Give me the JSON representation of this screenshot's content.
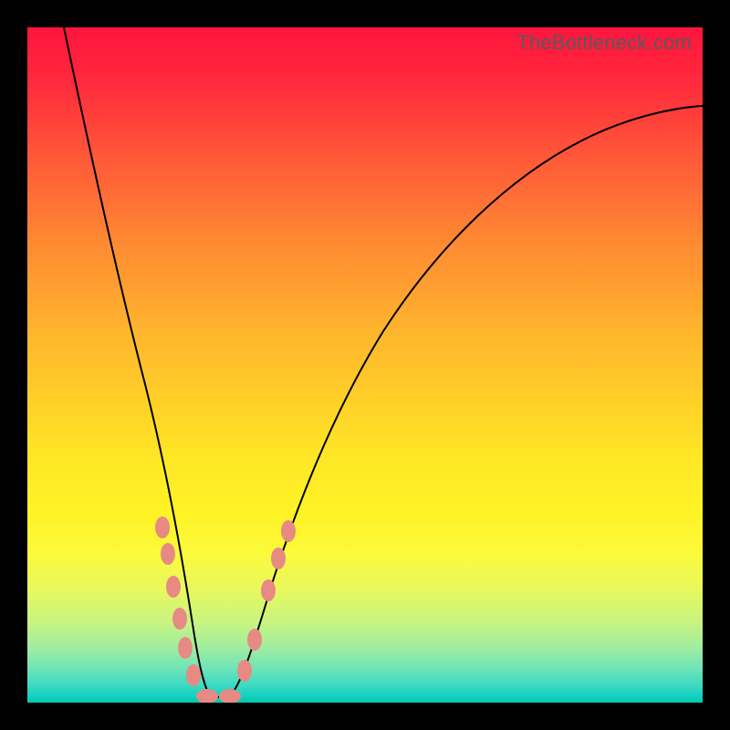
{
  "watermark": "TheBottleneck.com",
  "colors": {
    "frame": "#000000",
    "curve": "#000000",
    "marker": "#e78a84",
    "gradient_top": "#ff143e",
    "gradient_bottom": "#00c9a9"
  },
  "chart_data": {
    "type": "line",
    "title": "",
    "xlabel": "",
    "ylabel": "",
    "xlim": [
      0,
      100
    ],
    "ylim": [
      0,
      100
    ],
    "annotations": [
      {
        "text": "TheBottleneck.com",
        "pos": "top-right"
      }
    ],
    "series": [
      {
        "name": "left-curve",
        "x": [
          5.4,
          7.0,
          9.0,
          11.0,
          13.0,
          15.0,
          17.0,
          18.7,
          20.3,
          21.6,
          23.0,
          24.3,
          25.1,
          26.0
        ],
        "values": [
          100.0,
          89.9,
          78.5,
          67.6,
          57.6,
          48.4,
          39.9,
          32.1,
          24.1,
          17.2,
          10.3,
          4.9,
          2.2,
          0.8
        ]
      },
      {
        "name": "right-curve",
        "x": [
          30.8,
          31.6,
          32.4,
          33.8,
          35.4,
          37.8,
          40.5,
          43.2,
          45.9,
          48.6,
          52.0,
          56.1,
          60.8,
          66.2,
          72.3,
          79.1,
          85.8,
          93.9,
          100.0
        ],
        "values": [
          0.8,
          2.5,
          5.1,
          10.1,
          15.8,
          23.1,
          30.4,
          36.9,
          42.7,
          47.8,
          53.4,
          59.3,
          65.0,
          70.4,
          75.4,
          79.7,
          83.1,
          86.2,
          88.1
        ]
      }
    ],
    "markers": [
      {
        "series": "left",
        "x": 20.0,
        "y": 26.0,
        "rx": 1.1,
        "ry": 1.6
      },
      {
        "series": "left",
        "x": 20.8,
        "y": 22.0,
        "rx": 1.1,
        "ry": 1.6
      },
      {
        "series": "left",
        "x": 21.6,
        "y": 17.2,
        "rx": 1.1,
        "ry": 1.6
      },
      {
        "series": "left",
        "x": 22.6,
        "y": 12.4,
        "rx": 1.1,
        "ry": 1.6
      },
      {
        "series": "left",
        "x": 23.4,
        "y": 8.1,
        "rx": 1.1,
        "ry": 1.6
      },
      {
        "series": "left",
        "x": 24.6,
        "y": 4.1,
        "rx": 1.1,
        "ry": 1.6
      },
      {
        "series": "left-flat",
        "x": 26.6,
        "y": 0.9,
        "rx": 1.6,
        "ry": 1.1
      },
      {
        "series": "right-flat",
        "x": 30.0,
        "y": 0.9,
        "rx": 1.6,
        "ry": 1.1
      },
      {
        "series": "right",
        "x": 32.2,
        "y": 4.7,
        "rx": 1.1,
        "ry": 1.6
      },
      {
        "series": "right",
        "x": 33.6,
        "y": 9.3,
        "rx": 1.1,
        "ry": 1.6
      },
      {
        "series": "right",
        "x": 35.7,
        "y": 16.6,
        "rx": 1.1,
        "ry": 1.6
      },
      {
        "series": "right",
        "x": 37.2,
        "y": 21.4,
        "rx": 1.1,
        "ry": 1.6
      },
      {
        "series": "right",
        "x": 38.6,
        "y": 25.4,
        "rx": 1.1,
        "ry": 1.6
      }
    ]
  }
}
